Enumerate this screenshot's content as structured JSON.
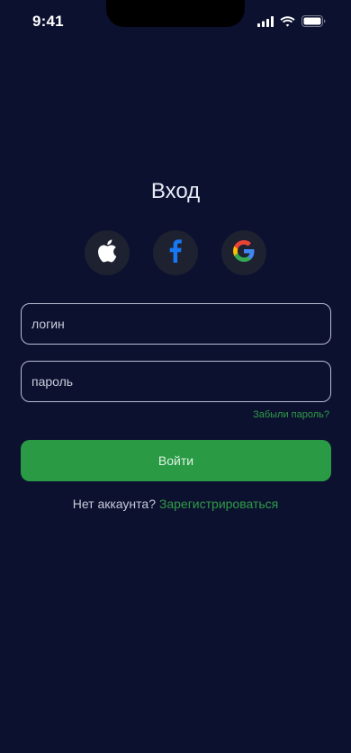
{
  "status_bar": {
    "time": "9:41",
    "icons": [
      "cellular-signal-icon",
      "wifi-icon",
      "battery-icon"
    ]
  },
  "login": {
    "title": "Вход",
    "social": [
      {
        "name": "apple-icon",
        "color": "#ffffff"
      },
      {
        "name": "facebook-icon",
        "color": "#1877f2"
      },
      {
        "name": "google-icon",
        "colors": [
          "#ea4335",
          "#fbbc05",
          "#34a853",
          "#4285f4"
        ]
      }
    ],
    "login_placeholder": "логин",
    "password_placeholder": "пароль",
    "forgot_password": "Забыли пароль?",
    "submit": "Войти",
    "no_account": "Нет аккаунта?",
    "register": "Зарегистрироваться"
  },
  "colors": {
    "background": "#0c1130",
    "accent": "#2a9a45",
    "social_button_bg": "#1d2130",
    "input_border": "#b9bdd0"
  }
}
